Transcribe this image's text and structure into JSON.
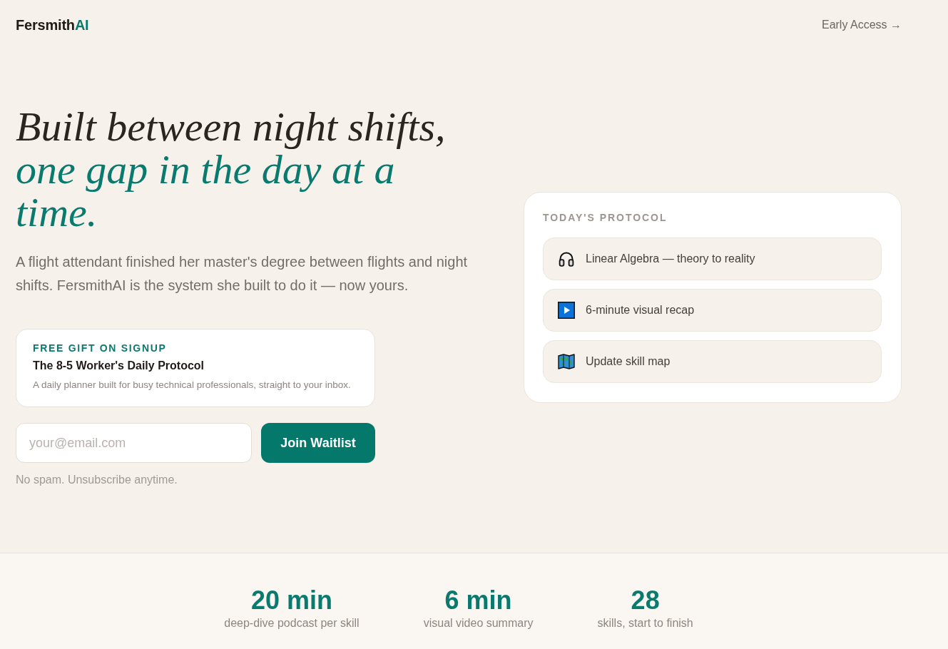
{
  "header": {
    "logo": {
      "text": "Fersmith",
      "accent": "AI"
    },
    "nav_link": "Early Access →"
  },
  "hero": {
    "headline": {
      "text": "Built between night shifts,",
      "accent": "one gap in the day at a time."
    },
    "intro": "A flight attendant finished her master's degree between flights and night shifts. FersmithAI is the system she built to do it — now yours.",
    "gift_card": {
      "eyebrow": "FREE GIFT ON SIGNUP",
      "title": "The 8-5 Worker's Daily Protocol",
      "description": "A daily planner built for busy technical professionals, straight to your inbox."
    },
    "signup": {
      "email_field": {
        "placeholder": "your@email.com"
      },
      "button": "Join Waitlist",
      "note": "No spam. Unsubscribe anytime."
    }
  },
  "protocol_card": {
    "heading": "TODAY'S PROTOCOL",
    "items": [
      {
        "kind": "headphones",
        "label": "Linear Algebra — theory to reality"
      },
      {
        "kind": "video",
        "label": "6-minute visual recap"
      },
      {
        "kind": "map",
        "label": "Update skill map"
      }
    ]
  },
  "stats": [
    {
      "value": "20 min",
      "label": "deep-dive podcast per skill"
    },
    {
      "value": "6 min",
      "label": "visual video summary"
    },
    {
      "value": "28",
      "label": "skills, start to finish"
    }
  ]
}
